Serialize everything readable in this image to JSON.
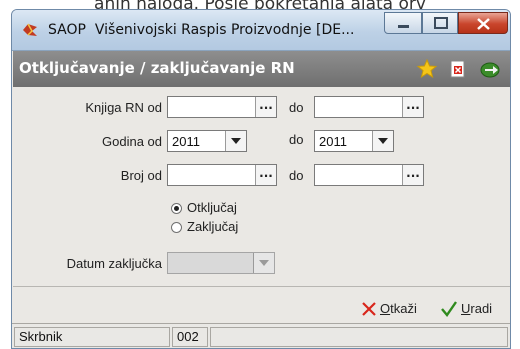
{
  "background_text": "anih naloga. Posle pokretanja alata orv",
  "window": {
    "app_name": "SAOP",
    "title": "Višenivojski Raspis Proizvodnje [DE...",
    "buttons": {
      "minimize": "minimize",
      "maximize": "maximize",
      "close": "close"
    }
  },
  "header": {
    "title": "Otključavanje / zaključavanje  RN",
    "icons": [
      "star-icon",
      "delete-doc-icon",
      "exit-icon"
    ]
  },
  "form": {
    "knjiga": {
      "label": "Knjiga RN od",
      "from_value": "",
      "to_label": "do",
      "to_value": "",
      "button": "..."
    },
    "godina": {
      "label": "Godina od",
      "from_value": "2011",
      "to_label": "do",
      "to_value": "2011"
    },
    "broj": {
      "label": "Broj od",
      "from_value": "",
      "to_label": "do",
      "to_value": "",
      "button": "..."
    },
    "mode": {
      "options": [
        "Otključaj",
        "Zaključaj"
      ],
      "selected": "Otključaj"
    },
    "datum": {
      "label": "Datum zaključka",
      "value": ""
    }
  },
  "actions": {
    "cancel": {
      "prefix": "",
      "underline": "O",
      "rest": "tkaži"
    },
    "execute": {
      "underline": "U",
      "rest": "radi"
    }
  },
  "status": {
    "label": "Skrbnik",
    "value": "002"
  },
  "colors": {
    "header_bg": "#7d7d7d",
    "window_bg": "#eae8e4",
    "close_btn": "#c9452c",
    "cancel_x": "#d8261b",
    "ok_check": "#2f8a1e"
  }
}
